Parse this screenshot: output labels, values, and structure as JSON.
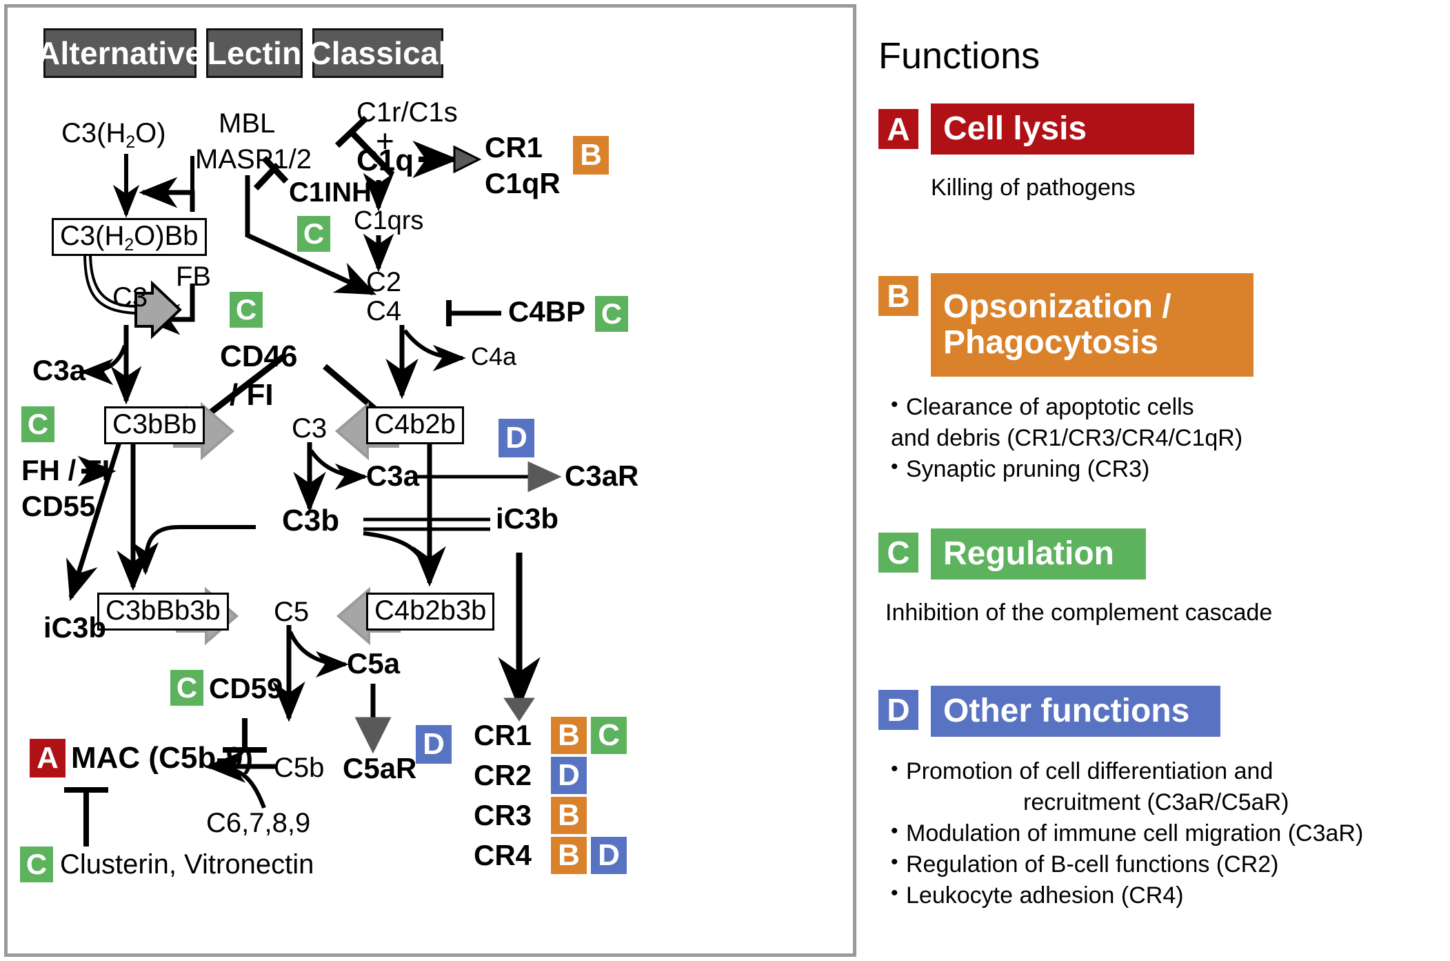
{
  "colors": {
    "red": "#b01116",
    "orange": "#d9822b",
    "green": "#5cb25d",
    "blue": "#5873c1",
    "header_gray": "#595959",
    "arrow_gray": "#a6a6a6",
    "arrow_dark_gray": "#595959",
    "panel_border": "#9a9a9a"
  },
  "diagram": {
    "pathways": [
      {
        "label": "Alternative"
      },
      {
        "label": "Lectin"
      },
      {
        "label": "Classical"
      }
    ],
    "nodes": {
      "c3h2o": "C3(H₂O)",
      "c3h2obb": "C3(H₂O)Bb",
      "fb": "FB",
      "c3_upper": "C3",
      "c3a_left": "C3a",
      "c3bbb": "C3bBb",
      "fhfi": "FH / FI",
      "cd55": "CD55",
      "c3bbb3b": "C3bBb3b",
      "ic3b_left": "iC3b",
      "mac": "MAC (C5b-9)",
      "clusterin": "Clusterin, Vitronectin",
      "mbl": "MBL",
      "masp": "MASP1/2",
      "c1inh": "C1INH",
      "cd46": "CD46",
      "fi": "/ FI",
      "c3_mid": "C3",
      "c3a_mid": "C3a",
      "c3b_mid": "C3b",
      "c5_mid": "C5",
      "c5a": "C5a",
      "c5b": "C5b",
      "c5ar": "C5aR",
      "cd59": "CD59",
      "c6789": "C6,7,8,9",
      "c1rc1s": "C1r/C1s",
      "plus": "+",
      "c1q": "C1q",
      "c1qrs": "C1qrs",
      "c2": "C2",
      "c4": "C4",
      "c4bp": "C4BP",
      "c4a": "C4a",
      "c4b2b": "C4b2b",
      "c4b2b3b": "C4b2b3b",
      "cr1_top": "CR1",
      "c1qr_top": "C1qR",
      "c3ar": "C3aR",
      "ic3b_right": "iC3b"
    },
    "receptors": [
      {
        "name": "CR1",
        "badges": [
          "B",
          "C"
        ]
      },
      {
        "name": "CR2",
        "badges": [
          "D"
        ]
      },
      {
        "name": "CR3",
        "badges": [
          "B"
        ]
      },
      {
        "name": "CR4",
        "badges": [
          "B",
          "D"
        ]
      }
    ]
  },
  "functions": {
    "title": "Functions",
    "items": [
      {
        "key": "A",
        "title": "Cell lysis",
        "color": "#b01116",
        "desc": "Killing of pathogens",
        "bullets": []
      },
      {
        "key": "B",
        "title": "Opsonization /\nPhagocytosis",
        "title_line1": "Opsonization /",
        "title_line2": "Phagocytosis",
        "color": "#d9822b",
        "desc": "",
        "bullets": [
          "Clearance of apoptotic cells\nand debris (CR1/CR3/CR4/C1qR)",
          "Synaptic pruning (CR3)"
        ],
        "bullet_lines": [
          [
            "Clearance of apoptotic cells",
            "and debris (CR1/CR3/CR4/C1qR)"
          ],
          [
            "Synaptic pruning (CR3)"
          ]
        ]
      },
      {
        "key": "C",
        "title": "Regulation",
        "color": "#5cb25d",
        "desc": "Inhibition of the complement cascade",
        "bullets": []
      },
      {
        "key": "D",
        "title": "Other functions",
        "color": "#5873c1",
        "desc": "",
        "bullets": [
          "Promotion of cell differentiation and\nrecruitment (C3aR/C5aR)",
          "Modulation of immune cell migration (C3aR)",
          "Regulation of B-cell functions (CR2)",
          "Leukocyte adhesion (CR4)"
        ],
        "bullet_lines": [
          [
            "Promotion of cell differentiation and",
            "recruitment (C3aR/C5aR)"
          ],
          [
            "Modulation of immune cell migration (C3aR)"
          ],
          [
            "Regulation of B-cell functions (CR2)"
          ],
          [
            "Leukocyte adhesion (CR4)"
          ]
        ]
      }
    ]
  }
}
